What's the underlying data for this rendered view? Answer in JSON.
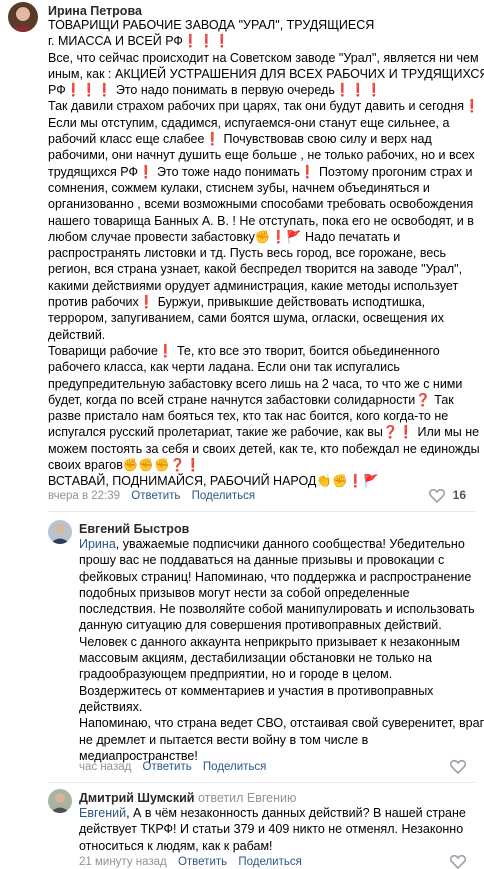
{
  "comment1": {
    "author": "Ирина Петрова",
    "lines": [
      "ТОВАРИЩИ РАБОЧИЕ ЗАВОДА \"УРАЛ\", ТРУДЯЩИЕСЯ",
      "г. МИАССА И ВСЕЙ РФ❗❗❗",
      "Все, что сейчас происходит на Советском заводе \"Урал\", является ни чем",
      "иным, как : АКЦИЕЙ УСТРАШЕНИЯ ДЛЯ ВСЕХ РАБОЧИХ И ТРУДЯЩИХСЯ",
      "РФ❗❗❗ Это надо понимать в первую очередь❗❗❗",
      "Так давили страхом рабочих при царях, так они будут давить и сегодня❗",
      "Если мы отступим, сдадимся, испугаемся-они станут еще сильнее, а",
      "рабочий класс еще слабее❗ Почувствовав свою силу и верх над",
      "рабочими, они начнут душить еще больше , не только рабочих, но и всех",
      "трудящихся РФ❗ Это тоже надо понимать❗ Поэтому прогоним страх и",
      "сомнения, сожмем кулаки, стиснем зубы, начнем объединяться и",
      "организованно , всеми возможными способами требовать освобождения",
      "нашего товарища Банных А. В. ! Не отступать, пока его не освободят, и в",
      "любом случае провести забастовку✊❗🚩 Надо печатать и",
      "распространять листовки и тд. Пусть весь город, все горожане, весь",
      "регион, вся страна узнает, какой беспредел творится на заводе \"Урал\",",
      "какими действиями орудует администрация, какие методы использует",
      "против рабочих❗ Буржуи, привыкшие действовать исподтишка,",
      "террором, запугиванием, сами боятся шума, огласки, освещения их",
      "действий.",
      "Товарищи рабочие❗ Те, кто все это творит, боится обьединенного",
      "рабочего класса, как черти ладана. Если они так испугались",
      "предупредительную забастовку всего лишь на 2 часа, то что же с ними",
      "будет, когда по всей стране начнутся забастовки солидарности❓ Так",
      "разве пристало нам бояться тех, кто так нас боится, кого когда-то не",
      "испугался русский пролетариат, такие же рабочие, как вы❓❗ Или мы не",
      "можем постоять за себя и своих детей, как те, кто побеждал не единожды",
      "своих врагов✊✊✊❓❗",
      "ВСТАВАЙ, ПОДНИМАЙСЯ, РАБОЧИЙ НАРОД👏✊❗🚩"
    ],
    "time": "вчера в 22:39",
    "reply_label": "Ответить",
    "share_label": "Поделиться",
    "likes": "16"
  },
  "comment2": {
    "author": "Евгений Быстров",
    "mention": "Ирина",
    "first_line_rest": ", уважаемые подписчики данного сообщества! Убедительно",
    "lines": [
      "прошу вас не поддаваться на данные призывы и провокации с",
      "фейковых страниц! Напоминаю, что поддержка и распространение",
      "подобных призывов могут нести за собой определенные",
      "последствия. Не позволяйте собой манипулировать и использовать",
      "данную ситуацию для совершения противоправных действий.",
      "Человек с данного аккаунта неприкрыто призывает к незаконным",
      "массовым акциям, дестабилизации обстановки не только на",
      "градообразующем предприятии, но и городе в целом.",
      "Воздержитесь от комментариев и участия в противоправных",
      "действиях.",
      "Напоминаю, что страна ведет СВО, отстаивая свой суверенитет, враг",
      "не дремлет и пытается вести войну в том числе в",
      "медиапространстве!"
    ],
    "time": "час назад",
    "reply_label": "Ответить",
    "share_label": "Поделиться"
  },
  "comment3": {
    "author": "Дмитрий Шумский",
    "replied_text": "ответил Евгению",
    "mention": "Евгений",
    "first_line_rest": ", А в чём незаконность данных действий? В нашей стране",
    "lines": [
      "действует ТКРФ! И статьи 379 и 409 никто не отменял. Незаконно",
      "относиться к людям, как к рабам!"
    ],
    "time": "21 минуту назад",
    "reply_label": "Ответить",
    "share_label": "Поделиться"
  },
  "colors": {
    "link": "#2a5885",
    "meta": "#939393",
    "divider": "#e7e8ec"
  },
  "icons": {
    "like": "heart-icon"
  }
}
